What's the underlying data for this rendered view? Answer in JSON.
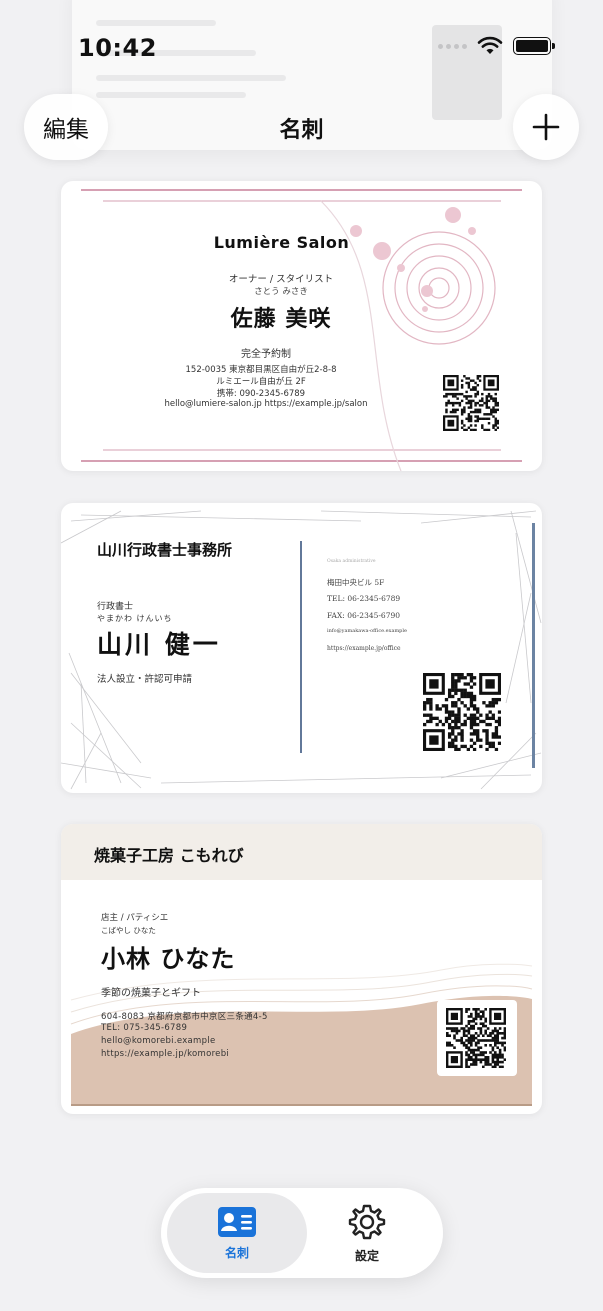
{
  "status_bar": {
    "time": "10:42"
  },
  "nav": {
    "edit_label": "編集",
    "title": "名刺",
    "add_label": "+"
  },
  "cards": [
    {
      "brand": "Lumière Salon",
      "role": "オーナー / スタイリスト",
      "kana": "さとう みさき",
      "name": "佐藤 美咲",
      "tagline": "完全予約制",
      "address1": "152-0035 東京都目黒区自由が丘2-8-8",
      "address2": "ルミエール自由が丘 2F",
      "phone": "携帯: 090-2345-6789",
      "contact": "hello@lumiere-salon.jp  https://example.jp/salon",
      "accent": "#c8819a"
    },
    {
      "office": "山川行政書士事務所",
      "role": "行政書士",
      "kana": "やまかわ けんいち",
      "name": "山川 健一",
      "service": "法人設立・許認可申請",
      "small_line": "Osaka administrative",
      "building": "梅田中央ビル 5F",
      "tel": "TEL: 06-2345-6789",
      "fax": "FAX: 06-2345-6790",
      "email": "info@yamakawa-office.example",
      "url": "https://example.jp/office",
      "accent": "#1f3f6e"
    },
    {
      "shop": "焼菓子工房 こもれび",
      "role": "店主 / パティシエ",
      "kana": "こばやし ひなた",
      "name": "小林 ひなた",
      "category": "季節の焼菓子とギフト",
      "address": "604-8083 京都府京都市中京区三条通4-5",
      "tel": "TEL: 075-345-6789",
      "email": "hello@komorebi.example",
      "url": "https://example.jp/komorebi",
      "accent": "#d9c2b2"
    }
  ],
  "tabbar": {
    "tabs": [
      {
        "label": "名刺",
        "icon": "contact-card-icon",
        "active": true
      },
      {
        "label": "設定",
        "icon": "gear-icon",
        "active": false
      }
    ],
    "accent": "#1a73d9"
  }
}
